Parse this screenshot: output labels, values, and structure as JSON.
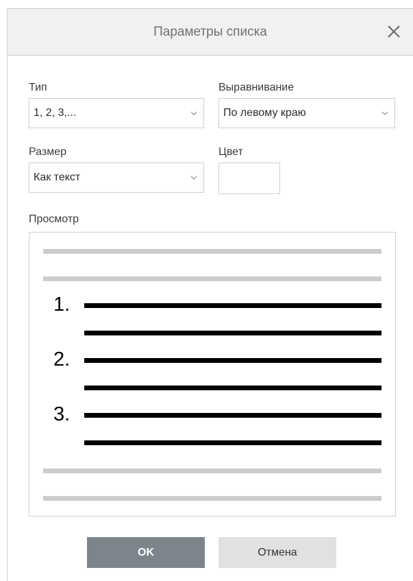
{
  "dialog": {
    "title": "Параметры списка",
    "close_icon": "close-icon"
  },
  "type_field": {
    "label": "Тип",
    "value": "1, 2, 3,..."
  },
  "alignment_field": {
    "label": "Выравнивание",
    "value": "По левому краю"
  },
  "size_field": {
    "label": "Размер",
    "value": "Как текст"
  },
  "color_field": {
    "label": "Цвет",
    "value": "#ffffff"
  },
  "preview": {
    "label": "Просмотр",
    "numbers": [
      "1.",
      "2.",
      "3."
    ]
  },
  "buttons": {
    "ok": "OK",
    "cancel": "Отмена"
  },
  "colors": {
    "titlebar_bg": "#f1f1f1",
    "ok_bg": "#7d858c",
    "cancel_bg": "#e1e1e1",
    "placeholder_line": "#cccccc",
    "list_line": "#000000"
  }
}
